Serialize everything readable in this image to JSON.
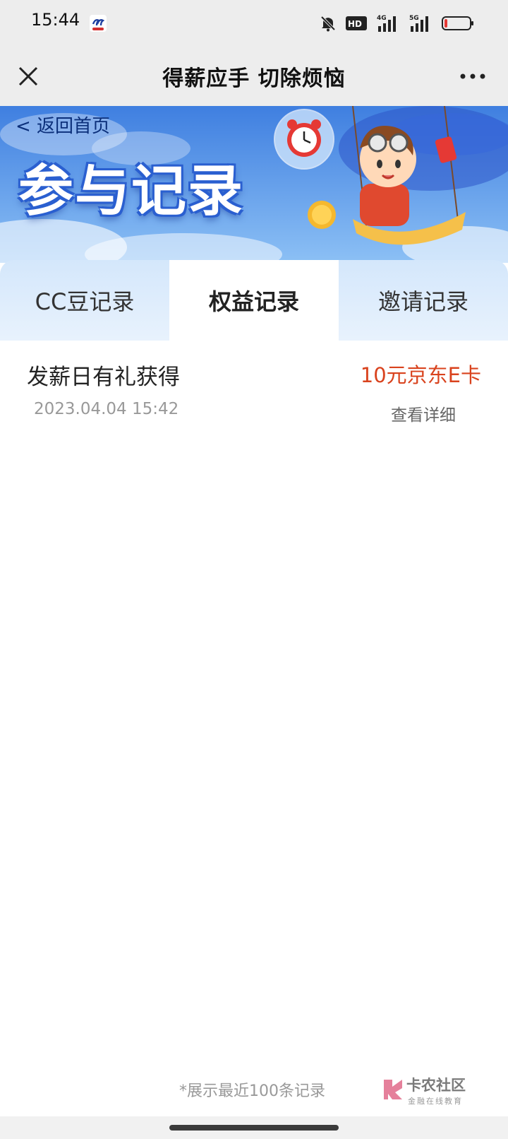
{
  "status_bar": {
    "time": "15:44",
    "icons": [
      "bell-off-icon",
      "hd-icon",
      "signal-4g-icon",
      "signal-5g-icon",
      "battery-low-icon"
    ],
    "hd_label": "HD",
    "net1": "4G",
    "net2": "5G",
    "battery_color": "#e53935"
  },
  "title_bar": {
    "title": "得薪应手 切除烦恼",
    "close_icon": "close-icon",
    "more_icon": "more-icon"
  },
  "banner": {
    "back_link": "< 返回首页",
    "title": "参与记录",
    "colors": {
      "sky": "#4d8fe8",
      "title_outline": "#2a5fd0"
    }
  },
  "tabs": [
    {
      "label": "CC豆记录",
      "active": false
    },
    {
      "label": "权益记录",
      "active": true
    },
    {
      "label": "邀请记录",
      "active": false
    }
  ],
  "records": [
    {
      "title": "发薪日有礼获得",
      "time": "2023.04.04 15:42",
      "prize": "10元京东E卡",
      "detail_link": "查看详细"
    }
  ],
  "footer": {
    "note": "*展示最近100条记录"
  },
  "watermark": {
    "name": "卡农社区",
    "tagline": "金融在线教育"
  },
  "colors": {
    "accent_red": "#d9431e",
    "tab_inactive_bg": "#d4e7fb"
  }
}
